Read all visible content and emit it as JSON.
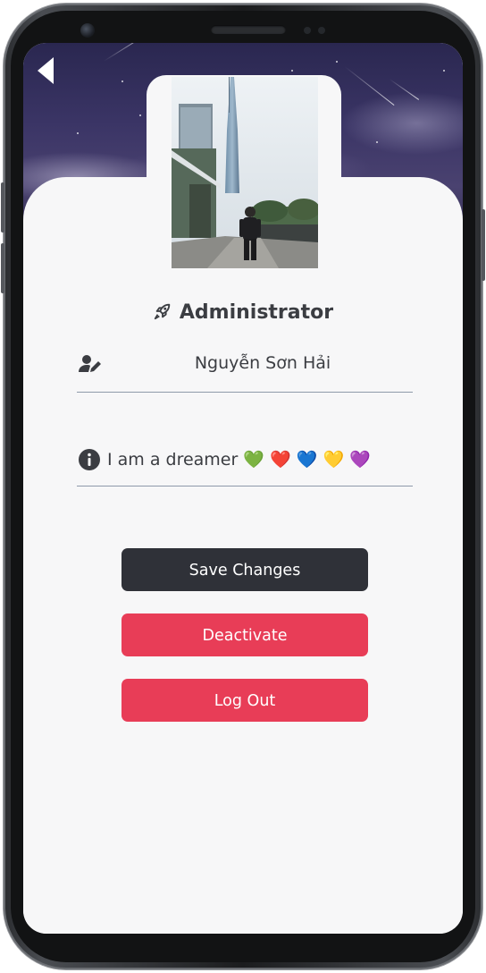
{
  "header": {
    "back_icon": "back-arrow-icon"
  },
  "profile": {
    "photo_icon": "profile-photo",
    "role_icon": "rocket-icon",
    "role": "Administrator"
  },
  "form": {
    "name_icon": "user-edit-icon",
    "name_value": "Nguyễn Sơn Hải",
    "bio_icon": "info-circle-icon",
    "bio_value": "I am a dreamer 💚 ❤️ 💙 💛 💜"
  },
  "actions": {
    "save_label": "Save Changes",
    "deactivate_label": "Deactivate",
    "logout_label": "Log Out"
  },
  "colors": {
    "primary_dark": "#2f3138",
    "danger": "#e83d57",
    "text": "#3b3d42",
    "underline": "#8e9aaa"
  }
}
